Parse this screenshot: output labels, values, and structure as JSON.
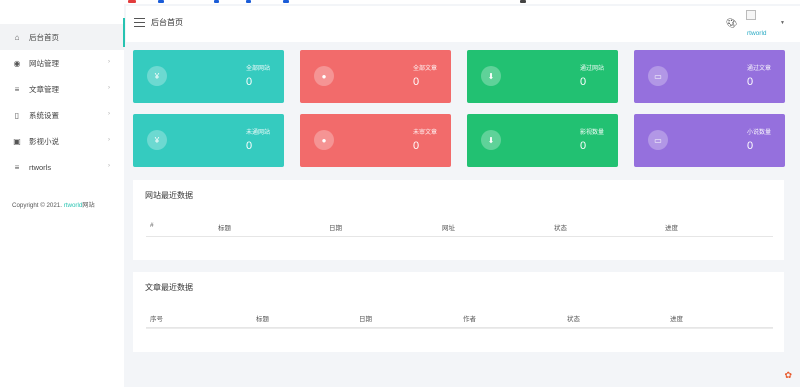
{
  "sidebar": {
    "items": [
      {
        "label": "后台首页",
        "icon": "home-icon",
        "glyph": "⌂",
        "active": true,
        "chevron": false
      },
      {
        "label": "网站管理",
        "icon": "globe-icon",
        "glyph": "◉",
        "active": false,
        "chevron": true
      },
      {
        "label": "文章管理",
        "icon": "list-icon",
        "glyph": "≡",
        "active": false,
        "chevron": true
      },
      {
        "label": "系统设置",
        "icon": "document-icon",
        "glyph": "▯",
        "active": false,
        "chevron": true
      },
      {
        "label": "影视小说",
        "icon": "image-icon",
        "glyph": "▣",
        "active": false,
        "chevron": true
      },
      {
        "label": "rtworls",
        "icon": "menu-icon",
        "glyph": "≡",
        "active": false,
        "chevron": true
      }
    ],
    "copyright_prefix": "Copyright © 2021.",
    "copyright_brand": "rtworld",
    "copyright_suffix": "网站"
  },
  "header": {
    "title": "后台首页",
    "username": "rtworld"
  },
  "stats": [
    {
      "label": "全部网站",
      "value": "0",
      "color": "#35cbbf",
      "icon": "yen-icon",
      "glyph": "¥"
    },
    {
      "label": "全部文章",
      "value": "0",
      "color": "#f26b6b",
      "icon": "user-icon",
      "glyph": "●"
    },
    {
      "label": "通过网站",
      "value": "0",
      "color": "#22c172",
      "icon": "download-icon",
      "glyph": "⬇"
    },
    {
      "label": "通过文章",
      "value": "0",
      "color": "#9570dd",
      "icon": "message-icon",
      "glyph": "▭"
    },
    {
      "label": "未通网站",
      "value": "0",
      "color": "#35cbbf",
      "icon": "yen-icon",
      "glyph": "¥"
    },
    {
      "label": "未审文章",
      "value": "0",
      "color": "#f26b6b",
      "icon": "user-icon",
      "glyph": "●"
    },
    {
      "label": "影视数量",
      "value": "0",
      "color": "#22c172",
      "icon": "download-icon",
      "glyph": "⬇"
    },
    {
      "label": "小说数量",
      "value": "0",
      "color": "#9570dd",
      "icon": "message-icon",
      "glyph": "▭"
    }
  ],
  "site_panel": {
    "title": "网站最近数据",
    "columns": [
      "#",
      "标题",
      "日期",
      "网址",
      "状态",
      "进度"
    ]
  },
  "article_panel": {
    "title": "文章最近数据",
    "columns": [
      "序号",
      "标题",
      "日期",
      "作者",
      "状态",
      "进度"
    ]
  }
}
